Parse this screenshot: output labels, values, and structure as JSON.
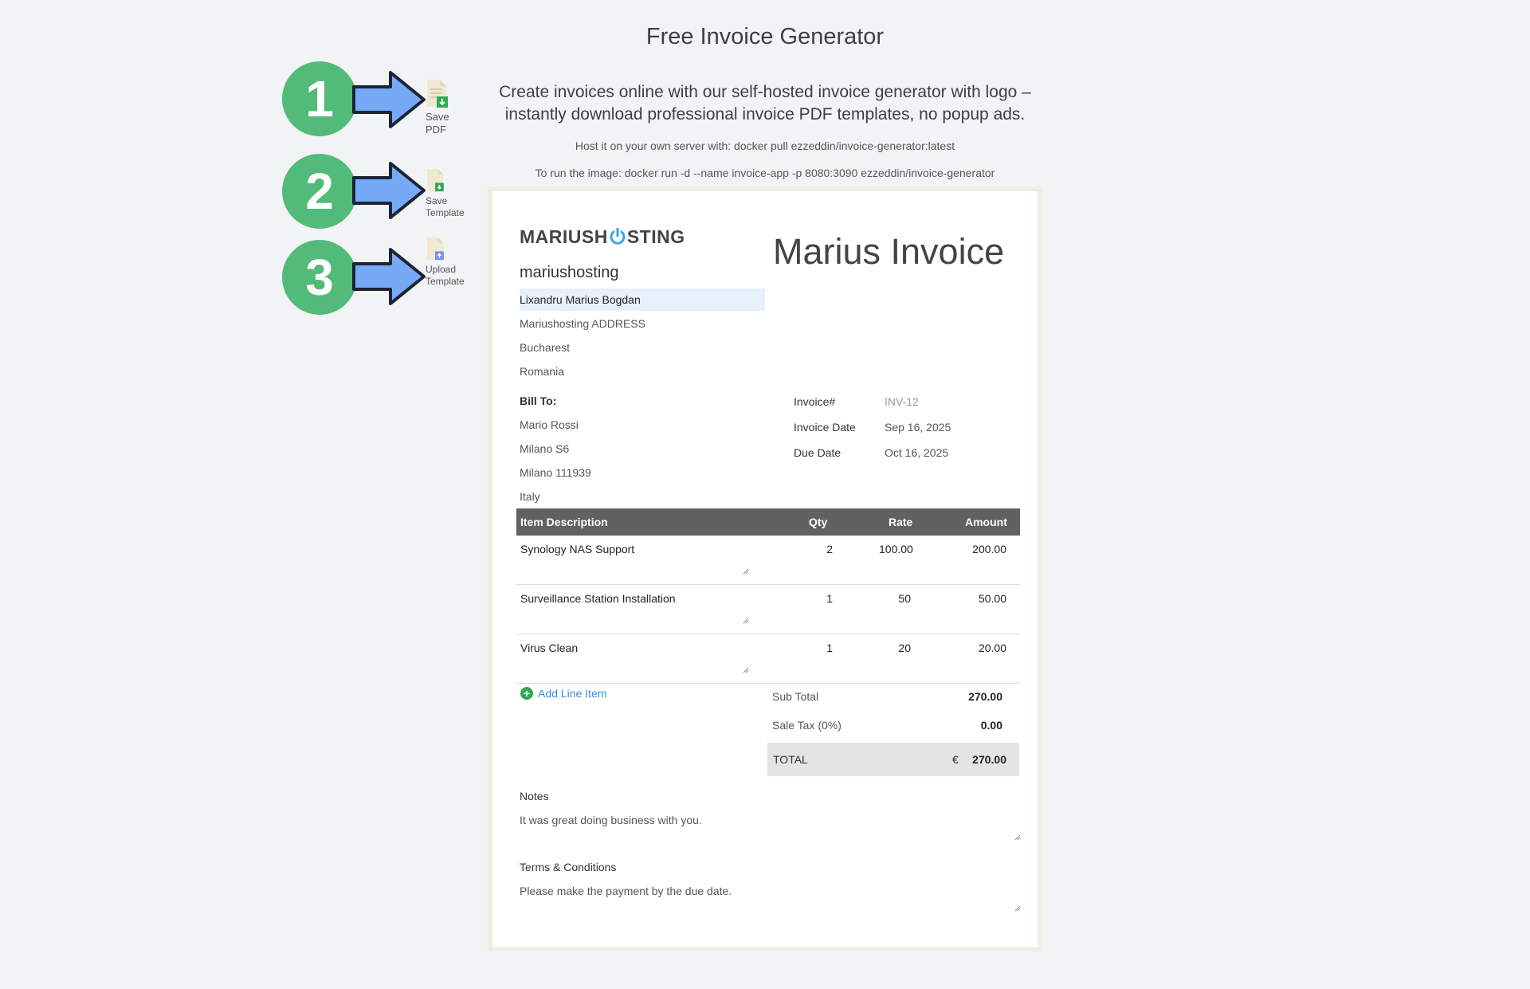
{
  "header": {
    "title": "Free Invoice Generator",
    "intro_line1": "Create invoices online with our self-hosted invoice generator with logo –",
    "intro_line2": "instantly download professional invoice PDF templates, no popup ads.",
    "hint_pull": "Host it on your own server with: docker pull ezzeddin/invoice-generator:latest",
    "hint_run": "To run the image: docker run -d --name invoice-app -p 8080:3090 ezzeddin/invoice-generator"
  },
  "tools": [
    {
      "step": "1",
      "label_line1": "Save",
      "label_line2": "PDF"
    },
    {
      "step": "2",
      "label_line1": "Save",
      "label_line2": "Template"
    },
    {
      "step": "3",
      "label_line1": "Upload",
      "label_line2": "Template"
    }
  ],
  "invoice": {
    "logo_text_left": "MARIUSH",
    "logo_text_right": "STING",
    "company_name": "mariushosting",
    "title": "Marius Invoice",
    "from": {
      "name": "Lixandru Marius Bogdan",
      "address": "Mariushosting ADDRESS",
      "city": "Bucharest",
      "country": "Romania"
    },
    "bill_to_label": "Bill To:",
    "bill_to": {
      "name": "Mario Rossi",
      "address": "Milano S6",
      "city": "Milano 111939",
      "country": "Italy"
    },
    "meta": {
      "number_label": "Invoice#",
      "number_value": "INV-12",
      "date_label": "Invoice Date",
      "date_value": "Sep 16, 2025",
      "due_label": "Due Date",
      "due_value": "Oct 16, 2025"
    },
    "table_headers": {
      "description": "Item Description",
      "qty": "Qty",
      "rate": "Rate",
      "amount": "Amount"
    },
    "items": [
      {
        "description": "Synology NAS Support",
        "qty": "2",
        "rate": "100.00",
        "amount": "200.00"
      },
      {
        "description": "Surveillance Station Installation",
        "qty": "1",
        "rate": "50",
        "amount": "50.00"
      },
      {
        "description": "Virus Clean",
        "qty": "1",
        "rate": "20",
        "amount": "20.00"
      }
    ],
    "add_line_label": "Add Line Item",
    "totals": {
      "subtotal_label": "Sub Total",
      "subtotal_value": "270.00",
      "tax_label": "Sale Tax (0%)",
      "tax_value": "0.00",
      "total_label": "TOTAL",
      "currency": "€",
      "total_value": "270.00"
    },
    "notes_label": "Notes",
    "notes_text": "It was great doing business with you.",
    "terms_label": "Terms & Conditions",
    "terms_text": "Please make the payment by the due date."
  },
  "colors": {
    "accent_green": "#52bb7a",
    "arrow_blue": "#76aaf7",
    "link_blue": "#3a8fd6",
    "table_header": "#616161"
  }
}
